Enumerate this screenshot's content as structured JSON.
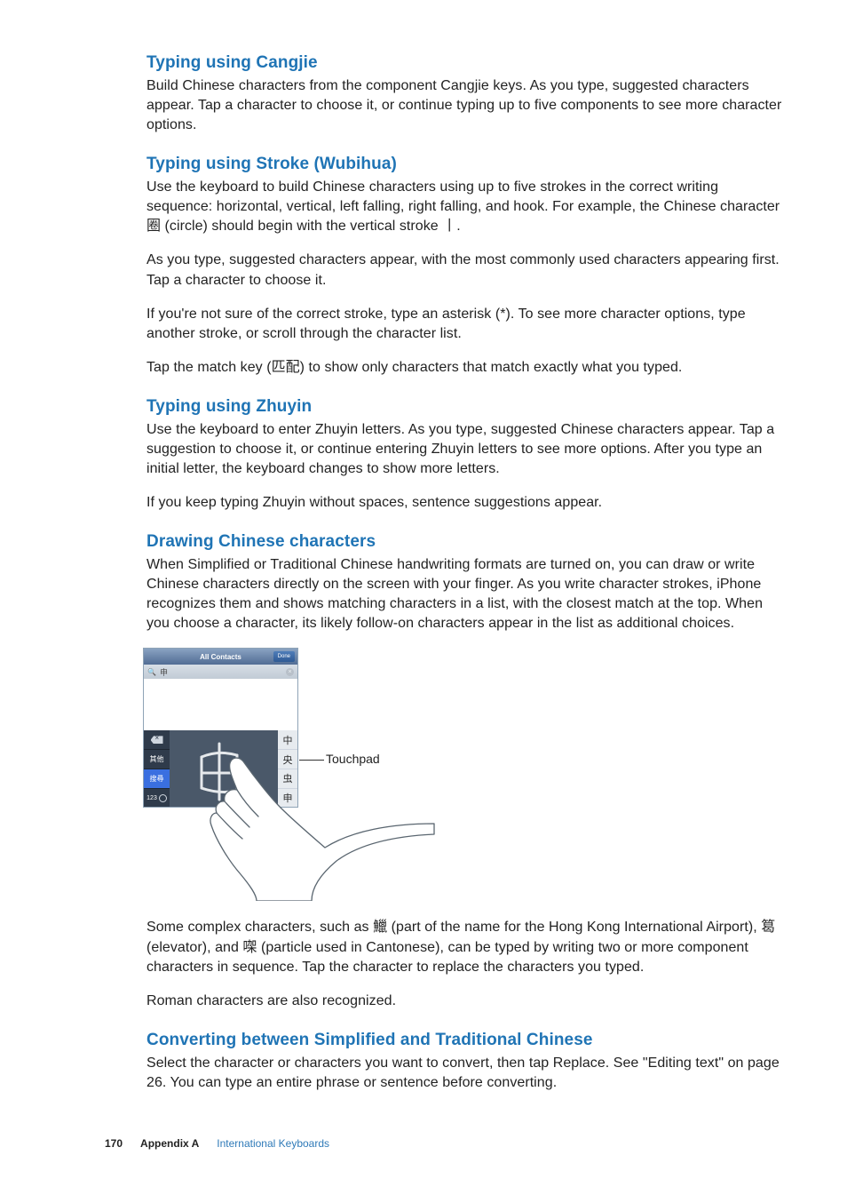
{
  "sections": {
    "cangjie": {
      "title": "Typing using Cangjie",
      "p1": "Build Chinese characters from the component Cangjie keys. As you type, suggested characters appear. Tap a character to choose it, or continue typing up to five components to see more character options."
    },
    "stroke": {
      "title": "Typing using Stroke (Wubihua)",
      "p1": "Use the keyboard to build Chinese characters using up to five strokes in the correct writing sequence: horizontal, vertical, left falling, right falling, and hook. For example, the Chinese character 圈 (circle) should begin with the vertical stroke 丨.",
      "p2": "As you type, suggested characters appear, with the most commonly used characters appearing first. Tap a character to choose it.",
      "p3": "If you're not sure of the correct stroke, type an asterisk (*). To see more character options, type another stroke, or scroll through the character list.",
      "p4": "Tap the match key (匹配) to show only characters that match exactly what you typed."
    },
    "zhuyin": {
      "title": "Typing using Zhuyin",
      "p1": "Use the keyboard to enter Zhuyin letters. As you type, suggested Chinese characters appear. Tap a suggestion to choose it, or continue entering Zhuyin letters to see more options. After you type an initial letter, the keyboard changes to show more letters.",
      "p2": "If you keep typing Zhuyin without spaces, sentence suggestions appear."
    },
    "drawing": {
      "title": "Drawing Chinese characters",
      "p1": "When Simplified or Traditional Chinese handwriting formats are turned on, you can draw or write Chinese characters directly on the screen with your finger. As you write character strokes, iPhone recognizes them and shows matching characters in a list, with the closest match at the top. When you choose a character, its likely follow-on characters appear in the list as additional choices.",
      "p2": "Some complex characters, such as 鱲 (part of the name for the Hong Kong International Airport), 䈓 (elevator), and 㗎 (particle used in Cantonese), can be typed by writing two or more component characters in sequence. Tap the character to replace the characters you typed.",
      "p3": "Roman characters are also recognized."
    },
    "convert": {
      "title": "Converting between Simplified and Traditional Chinese",
      "p1": "Select the character or characters you want to convert, then tap Replace. See \"Editing text\" on page 26. You can type an entire phrase or sentence before converting."
    }
  },
  "figure": {
    "navbar_title": "All Contacts",
    "done": "Done",
    "search_char": "申",
    "left_keys": {
      "other": "其他",
      "search": "搜尋",
      "nums": "123"
    },
    "suggestions": [
      "中",
      "央",
      "虫",
      "申"
    ],
    "callout": "Touchpad"
  },
  "footer": {
    "page": "170",
    "appendix": "Appendix A",
    "breadcrumb": "International Keyboards"
  }
}
